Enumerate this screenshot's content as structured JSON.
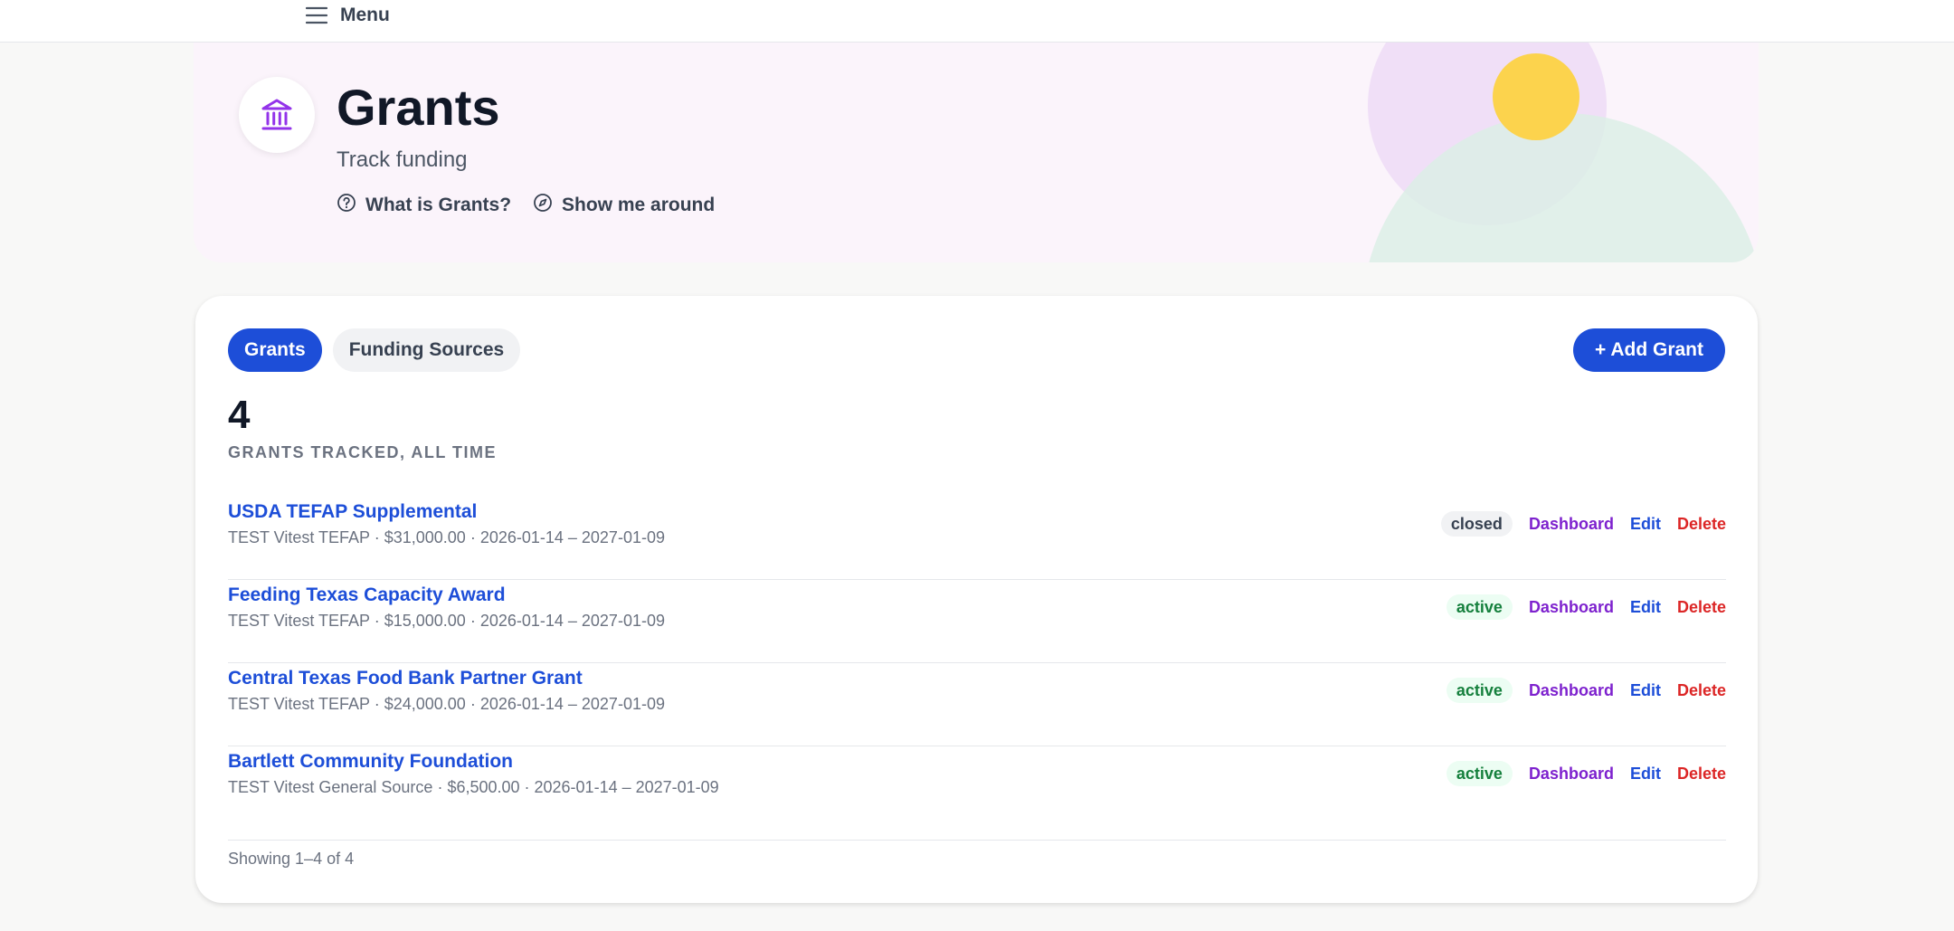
{
  "topbar": {
    "menu_label": "Menu"
  },
  "hero": {
    "title": "Grants",
    "subtitle": "Track funding",
    "help_link": "What is Grants?",
    "tour_link": "Show me around"
  },
  "tabs": [
    {
      "label": "Grants",
      "active": true
    },
    {
      "label": "Funding Sources",
      "active": false
    }
  ],
  "add_button": "+ Add Grant",
  "stats": {
    "count": "4",
    "label": "GRANTS TRACKED, ALL TIME"
  },
  "grants": [
    {
      "title": "USDA TEFAP Supplemental",
      "meta": "TEST Vitest TEFAP · $31,000.00 · 2026-01-14 – 2027-01-09",
      "status": "closed",
      "dashboard": "Dashboard",
      "edit": "Edit",
      "delete": "Delete"
    },
    {
      "title": "Feeding Texas Capacity Award",
      "meta": "TEST Vitest TEFAP · $15,000.00 · 2026-01-14 – 2027-01-09",
      "status": "active",
      "dashboard": "Dashboard",
      "edit": "Edit",
      "delete": "Delete"
    },
    {
      "title": "Central Texas Food Bank Partner Grant",
      "meta": "TEST Vitest TEFAP · $24,000.00 · 2026-01-14 – 2027-01-09",
      "status": "active",
      "dashboard": "Dashboard",
      "edit": "Edit",
      "delete": "Delete"
    },
    {
      "title": "Bartlett Community Foundation",
      "meta": "TEST Vitest General Source · $6,500.00 · 2026-01-14 – 2027-01-09",
      "status": "active",
      "dashboard": "Dashboard",
      "edit": "Edit",
      "delete": "Delete"
    }
  ],
  "footer": "Showing 1–4 of 4",
  "colors": {
    "primary": "#1d4ed8",
    "dashboard": "#7e22ce",
    "delete": "#dc2626",
    "active_badge": "#15803d",
    "hero_bg": "#fbf4fb",
    "deco_yellow": "#fcd34d"
  }
}
